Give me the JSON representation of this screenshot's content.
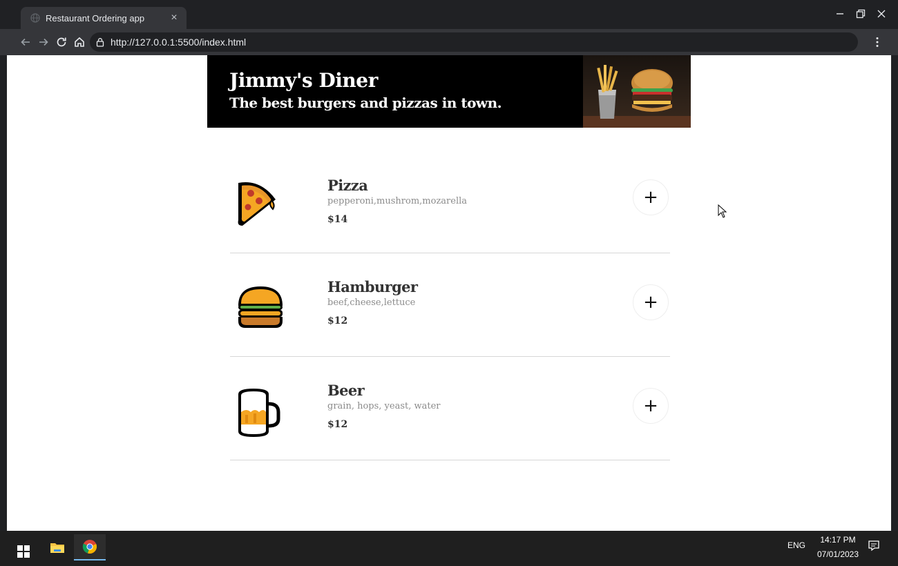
{
  "browser": {
    "tab_title": "Restaurant Ordering app",
    "tab_close_glyph": "×",
    "url": "http://127.0.0.1:5500/index.html",
    "icons": [
      "globe-icon",
      "back-icon",
      "forward-icon",
      "reload-icon",
      "home-icon",
      "lock-icon",
      "kebab-menu-icon",
      "minimize-icon",
      "restore-icon",
      "close-icon"
    ]
  },
  "page": {
    "banner": {
      "title": "Jimmy's Diner",
      "subtitle": "The best burgers and pizzas in town."
    },
    "menu": [
      {
        "name": "Pizza",
        "ingredients": "pepperoni,mushrom,mozarella",
        "price": "$14",
        "icon": "pizza-icon",
        "add_label": "+"
      },
      {
        "name": "Hamburger",
        "ingredients": "beef,cheese,lettuce",
        "price": "$12",
        "icon": "hamburger-icon",
        "add_label": "+"
      },
      {
        "name": "Beer",
        "ingredients": "grain, hops, yeast, water",
        "price": "$12",
        "icon": "beer-icon",
        "add_label": "+"
      }
    ],
    "colors": {
      "banner_bg": "#000000",
      "divider": "#d7d7d7",
      "accent_yellow": "#f5a623"
    }
  },
  "taskbar": {
    "language": "ENG",
    "time": "14:17 PM",
    "date": "07/01/2023",
    "apps": [
      "windows-start-icon",
      "file-explorer-icon",
      "chrome-icon"
    ]
  }
}
